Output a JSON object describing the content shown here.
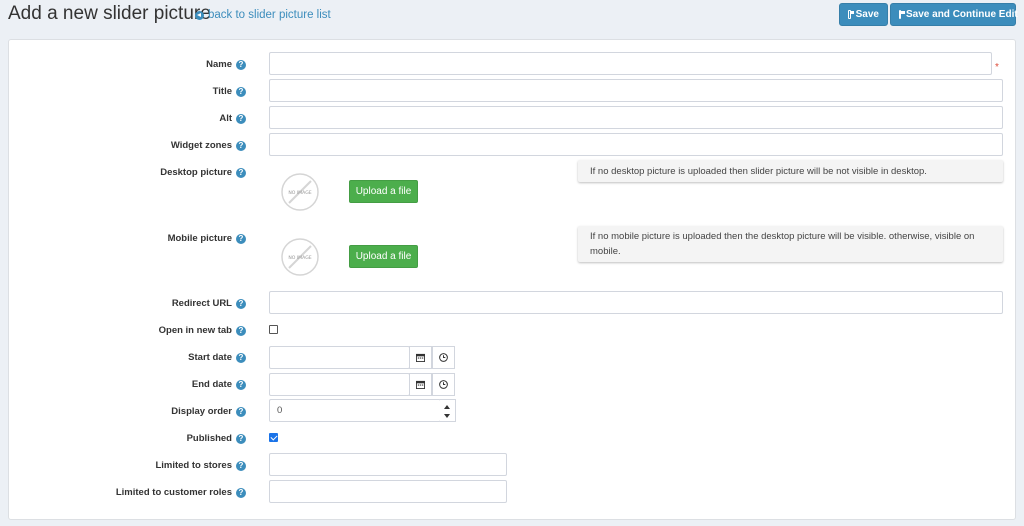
{
  "header": {
    "title": "Add a new slider picture",
    "back_link": "back to slider picture list",
    "save_label": "Save",
    "save_continue_label": "Save and Continue Edit"
  },
  "form": {
    "required_mark": "*",
    "help_glyph": "?",
    "name_label": "Name",
    "title_label": "Title",
    "alt_label": "Alt",
    "widget_zones_label": "Widget zones",
    "desktop_picture_label": "Desktop picture",
    "mobile_picture_label": "Mobile picture",
    "no_image_text": "NO IMAGE",
    "upload_label": "Upload a file",
    "desktop_note": "If no desktop picture is uploaded then slider picture will be not visible in desktop.",
    "mobile_note": "If no mobile picture is uploaded then the desktop picture will be visible. otherwise, visible on mobile.",
    "redirect_url_label": "Redirect URL",
    "open_new_tab_label": "Open in new tab",
    "open_new_tab_checked": false,
    "start_date_label": "Start date",
    "end_date_label": "End date",
    "display_order_label": "Display order",
    "display_order_value": "0",
    "published_label": "Published",
    "published_checked": true,
    "limited_stores_label": "Limited to stores",
    "limited_roles_label": "Limited to customer roles"
  },
  "colors": {
    "primary": "#3c8dbc",
    "success": "#4cae4c",
    "required": "#dd4b39",
    "checkbox_checked": "#1a73e8"
  }
}
